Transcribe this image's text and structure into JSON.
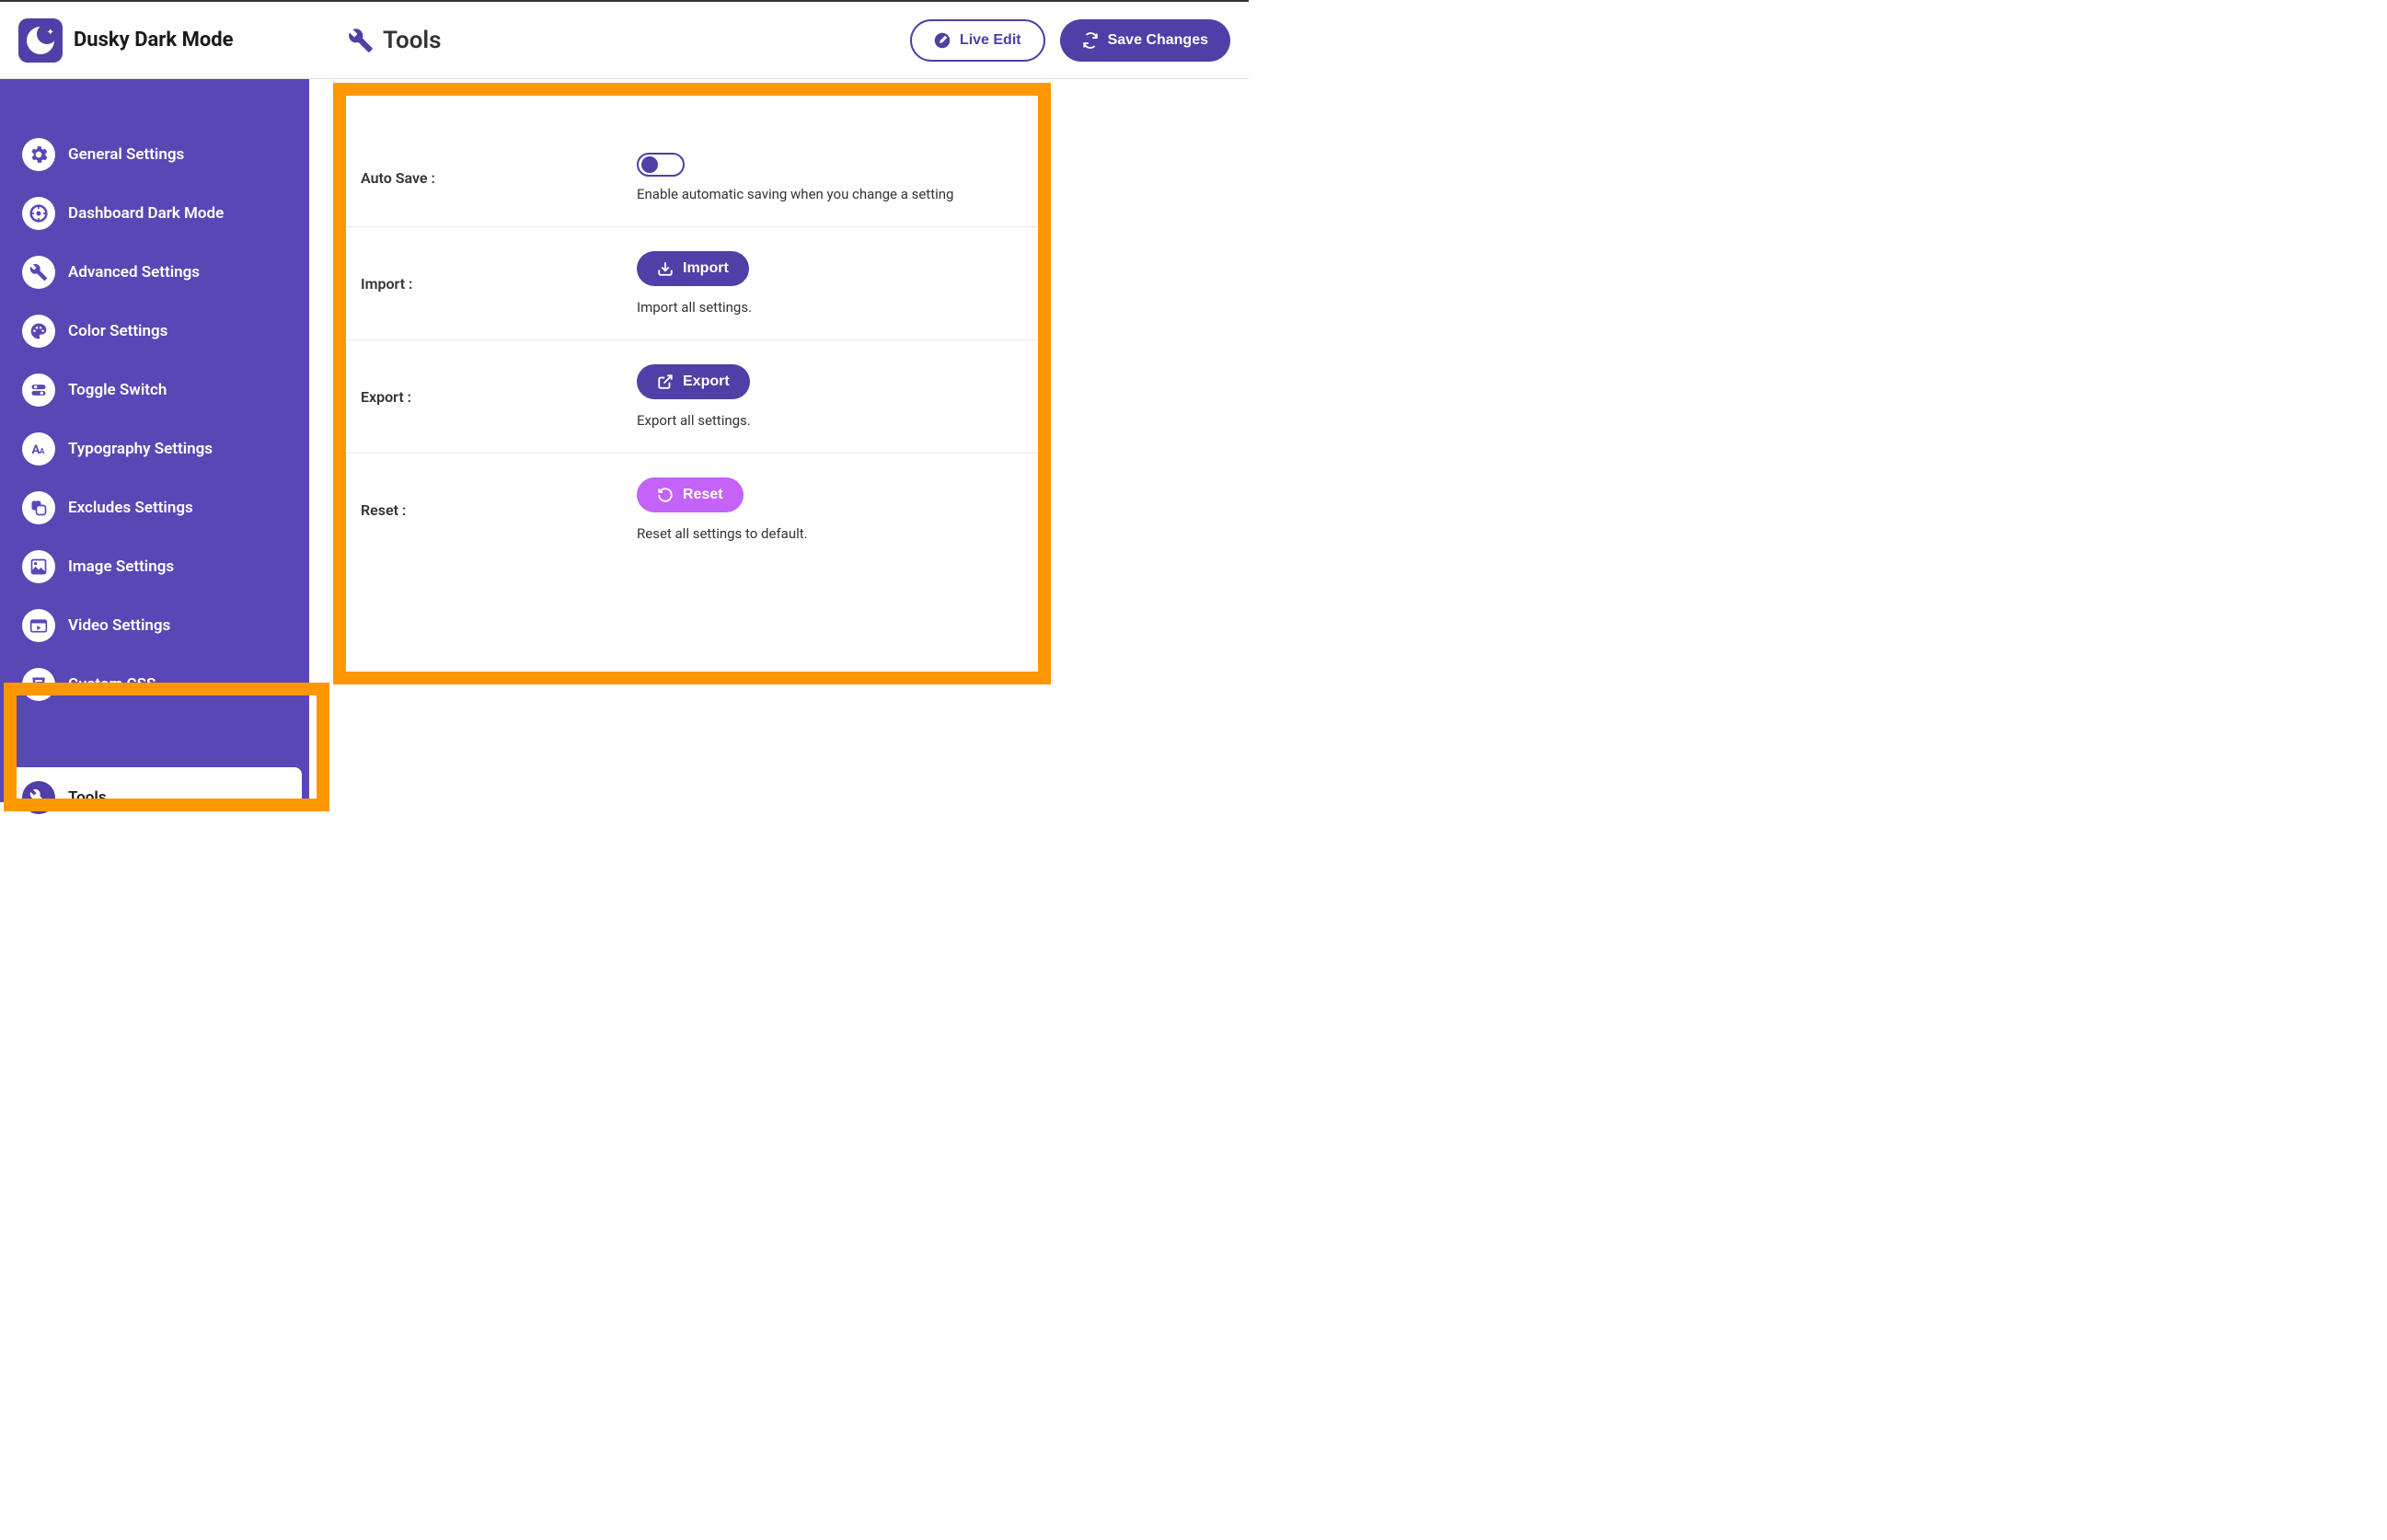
{
  "app": {
    "name": "Dusky Dark Mode"
  },
  "header": {
    "page_title": "Tools",
    "live_edit_label": "Live Edit",
    "save_changes_label": "Save Changes"
  },
  "sidebar": {
    "items": [
      {
        "label": "General Settings",
        "icon": "gear"
      },
      {
        "label": "Dashboard Dark Mode",
        "icon": "target"
      },
      {
        "label": "Advanced Settings",
        "icon": "wrench"
      },
      {
        "label": "Color Settings",
        "icon": "palette"
      },
      {
        "label": "Toggle Switch",
        "icon": "toggle"
      },
      {
        "label": "Typography Settings",
        "icon": "typography"
      },
      {
        "label": "Excludes Settings",
        "icon": "exclude"
      },
      {
        "label": "Image Settings",
        "icon": "image"
      },
      {
        "label": "Video Settings",
        "icon": "video"
      },
      {
        "label": "Custom CSS",
        "icon": "css"
      },
      {
        "label": "",
        "icon": ""
      },
      {
        "label": "Tools",
        "icon": "tools"
      }
    ]
  },
  "settings": {
    "auto_save": {
      "label": "Auto Save :",
      "desc": "Enable automatic saving when you change a setting"
    },
    "import": {
      "label": "Import :",
      "button": "Import",
      "desc": "Import all settings."
    },
    "export": {
      "label": "Export :",
      "button": "Export",
      "desc": "Export all settings."
    },
    "reset": {
      "label": "Reset :",
      "button": "Reset",
      "desc": "Reset all settings to default."
    }
  }
}
